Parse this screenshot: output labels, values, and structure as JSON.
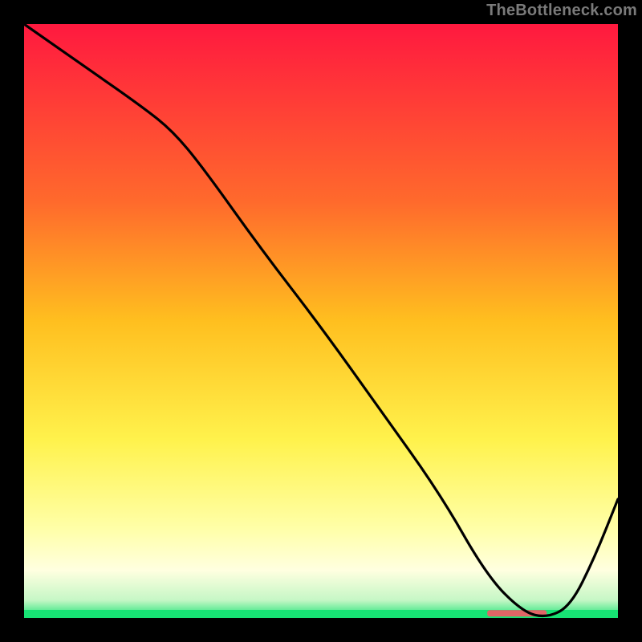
{
  "watermark": "TheBottleneck.com",
  "chart_data": {
    "type": "line",
    "title": "",
    "xlabel": "",
    "ylabel": "",
    "xlim": [
      0,
      100
    ],
    "ylim": [
      0,
      100
    ],
    "x": [
      0,
      10,
      20,
      25,
      30,
      40,
      50,
      60,
      70,
      78,
      84,
      88,
      92,
      96,
      100
    ],
    "values": [
      100,
      93,
      86,
      82,
      76,
      62,
      49,
      35,
      21,
      7,
      1,
      0,
      2,
      10,
      20
    ],
    "gradient_stops": [
      {
        "offset": 0.0,
        "color": "#ff193f"
      },
      {
        "offset": 0.3,
        "color": "#ff6a2c"
      },
      {
        "offset": 0.5,
        "color": "#ffbf1f"
      },
      {
        "offset": 0.7,
        "color": "#fff24c"
      },
      {
        "offset": 0.85,
        "color": "#ffffa8"
      },
      {
        "offset": 0.92,
        "color": "#ffffe0"
      },
      {
        "offset": 0.97,
        "color": "#c6f7c6"
      },
      {
        "offset": 1.0,
        "color": "#17e374"
      }
    ],
    "marker": {
      "x_frac_start": 0.78,
      "x_frac_end": 0.88,
      "y_frac": 0.995,
      "color": "#e06666"
    }
  }
}
